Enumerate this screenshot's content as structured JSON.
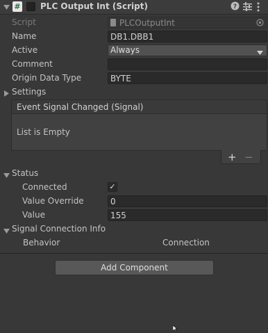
{
  "component": {
    "title": "PLC Output Int (Script)",
    "icons": [
      "foldout-arrow-icon",
      "script-hash-icon",
      "enabled-checkbox",
      "help-icon",
      "preset-icon",
      "context-menu-icon"
    ]
  },
  "fields": {
    "script": {
      "label": "Script",
      "value": "PLCOutputInt"
    },
    "name": {
      "label": "Name",
      "value": "DB1.DBB1"
    },
    "active": {
      "label": "Active",
      "value": "Always"
    },
    "comment": {
      "label": "Comment",
      "value": ""
    },
    "origin_data_type": {
      "label": "Origin Data Type",
      "value": "BYTE"
    }
  },
  "settings": {
    "label": "Settings",
    "event": {
      "header": "Event Signal Changed (Signal)",
      "empty_text": "List is Empty",
      "add": "+",
      "remove": "−"
    }
  },
  "status": {
    "label": "Status",
    "connected": {
      "label": "Connected",
      "checked": true,
      "mark": "✓"
    },
    "value_override": {
      "label": "Value Override",
      "value": "0"
    },
    "value": {
      "label": "Value",
      "value": "155"
    }
  },
  "signal_connection": {
    "label": "Signal Connection Info",
    "columns": [
      "Behavior",
      "Connection"
    ]
  },
  "add_component": {
    "label": "Add Component"
  },
  "colors": {
    "background": "#383838",
    "field": "#2a2a2a",
    "dropdown": "#515151",
    "button": "#585858"
  }
}
